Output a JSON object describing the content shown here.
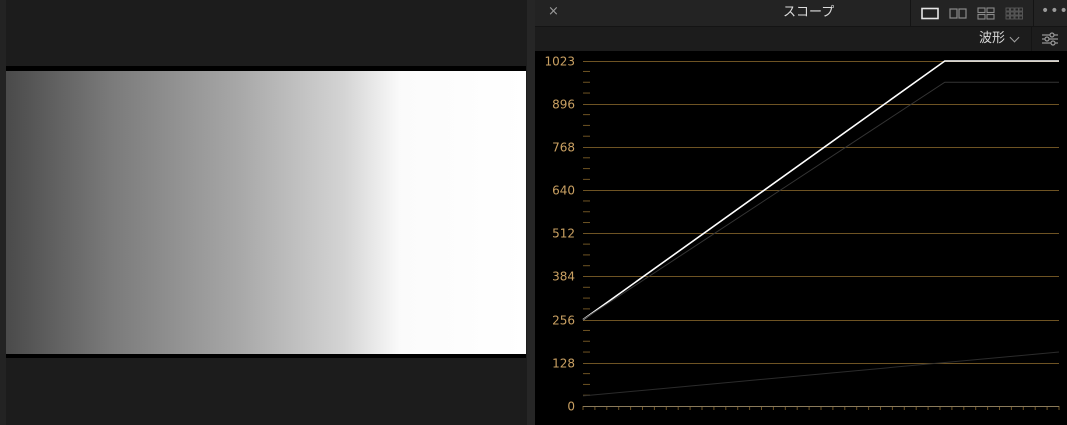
{
  "scope": {
    "title": "スコープ",
    "mode": "波形",
    "close_glyph": "×",
    "more_glyph": "•••",
    "icons": [
      "close-icon",
      "layout-single-icon",
      "layout-dual-icon",
      "layout-quad-icon",
      "layout-multi-icon",
      "more-icon",
      "chevron-down-icon",
      "settings-sliders-icon"
    ],
    "active_layout": "single",
    "colors": {
      "grid": "#6e5323",
      "labels": "#c9a062",
      "trace": "#ffffff"
    }
  },
  "chart_data": {
    "type": "line",
    "title": "",
    "xlabel": "",
    "ylabel": "",
    "ylim": [
      0,
      1023
    ],
    "xlim": [
      0,
      1
    ],
    "y_ticks": [
      0,
      128,
      256,
      384,
      512,
      640,
      768,
      896,
      1023
    ],
    "grid": true,
    "series": [
      {
        "x": [
          0,
          0.76,
          1
        ],
        "y": [
          256,
          1023,
          1023
        ]
      },
      {
        "x": [
          0,
          0.76,
          1
        ],
        "y": [
          256,
          960,
          960
        ]
      },
      {
        "x": [
          0,
          1
        ],
        "y": [
          30,
          160
        ]
      }
    ]
  }
}
